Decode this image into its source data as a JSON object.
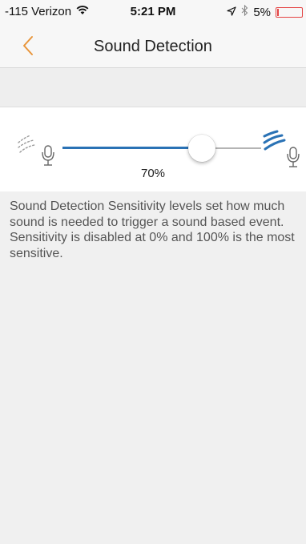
{
  "status_bar": {
    "carrier": "-115 Verizon",
    "time": "5:21 PM",
    "battery_percent": "5%",
    "battery_level": 0.05,
    "battery_color": "#e44444",
    "icons": [
      "wifi-icon",
      "location-arrow-icon",
      "bluetooth-icon",
      "battery-icon"
    ]
  },
  "nav": {
    "title": "Sound Detection",
    "back_icon": "chevron-left-icon",
    "accent_color": "#e8953a"
  },
  "sensitivity": {
    "value": 70,
    "value_label": "70%",
    "track_active_color": "#2a72b5",
    "track_inactive_color": "#b4b4b4",
    "low_icon": "quiet-sound-icon",
    "high_icon": "loud-sound-icon"
  },
  "description": "Sound Detection Sensitivity levels set how much sound is needed to trigger a sound based event. Sensitivity is disabled at 0% and 100% is the most sensitive."
}
